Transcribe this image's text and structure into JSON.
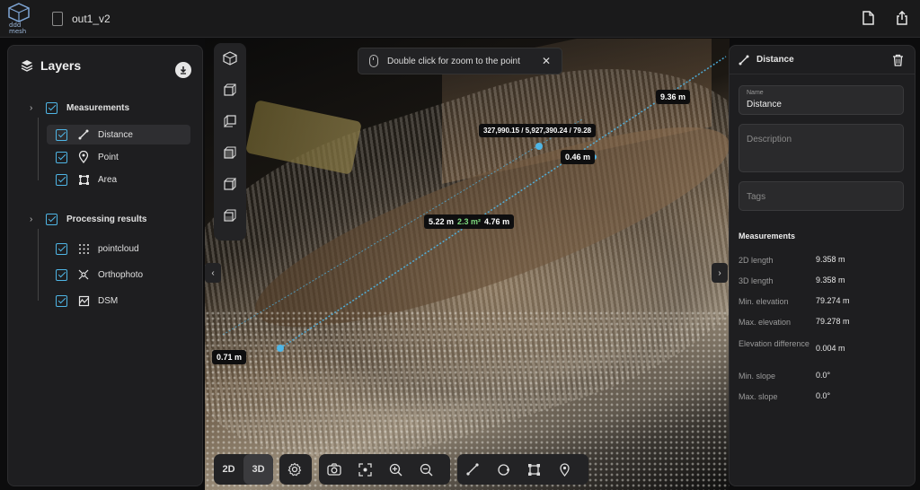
{
  "app": {
    "logo_text": "ddd\nmesh",
    "project_name": "out1_v2",
    "actions": [
      "file-icon",
      "share-icon"
    ]
  },
  "toast": {
    "text": "Double click for zoom to the point"
  },
  "viewport": {
    "labels": {
      "coords": "327,990.15 / 5,927,390.24 / 79.28",
      "total": "9.36 m",
      "seg_a": "0.46 m",
      "width_a": "5.22 m",
      "area": "2.3 m²",
      "width_b": "4.76 m",
      "seg_b": "0.71 m"
    },
    "accent_color": "#4fb6e6"
  },
  "layers": {
    "title": "Layers",
    "groups": [
      {
        "title": "Measurements",
        "items": [
          {
            "label": "Distance",
            "icon": "ruler-icon",
            "selected": true
          },
          {
            "label": "Point",
            "icon": "pin-icon"
          },
          {
            "label": "Area",
            "icon": "area-icon"
          }
        ]
      },
      {
        "title": "Processing results",
        "items": [
          {
            "label": "pointcloud",
            "icon": "pointcloud-icon"
          },
          {
            "label": "Orthophoto",
            "icon": "orthophoto-icon"
          },
          {
            "label": "DSM",
            "icon": "dsm-icon"
          }
        ]
      }
    ]
  },
  "props": {
    "title": "Distance",
    "name_label": "Name",
    "name_value": "Distance",
    "description_placeholder": "Description",
    "tags_placeholder": "Tags",
    "measurements_title": "Measurements",
    "rows": [
      {
        "key": "2D length",
        "value": "9.358 m"
      },
      {
        "key": "3D length",
        "value": "9.358 m"
      },
      {
        "key": "Min. elevation",
        "value": "79.274 m"
      },
      {
        "key": "Max. elevation",
        "value": "79.278 m"
      },
      {
        "key": "Elevation difference",
        "value": "0.004 m"
      },
      {
        "key": "Min. slope",
        "value": "0.0°"
      },
      {
        "key": "Max. slope",
        "value": "0.0°"
      }
    ]
  },
  "toolbar": {
    "mode_2d": "2D",
    "mode_3d": "3D",
    "active_mode": "3D"
  }
}
